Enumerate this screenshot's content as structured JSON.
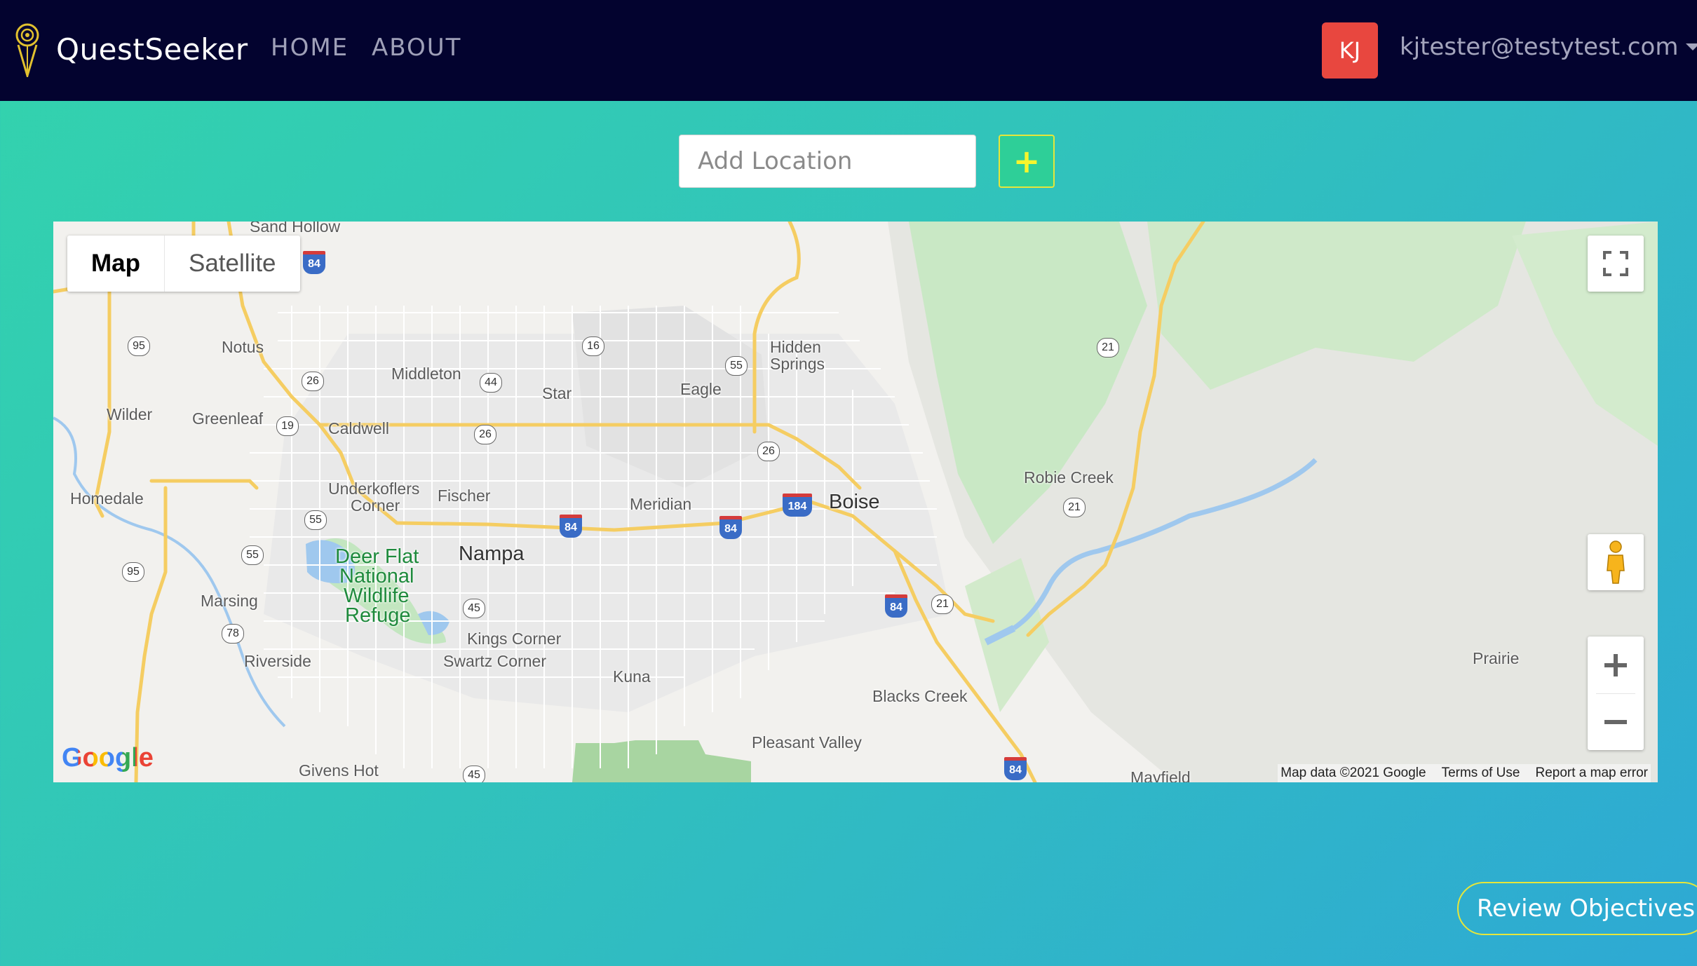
{
  "nav": {
    "brand": "QuestSeeker",
    "home": "HOME",
    "about": "ABOUT",
    "avatar_initials": "KJ",
    "user_email": "kjtester@testytest.com"
  },
  "location": {
    "placeholder": "Add Location",
    "add_label": "+"
  },
  "map": {
    "type_map": "Map",
    "type_satellite": "Satellite",
    "google": "Google",
    "attribution": [
      "Map data ©2021 Google",
      "Terms of Use",
      "Report a map error"
    ],
    "places": {
      "sand_hollow": "Sand Hollow",
      "notus": "Notus",
      "middleton": "Middleton",
      "star": "Star",
      "eagle": "Eagle",
      "hidden": "Hidden",
      "springs": "Springs",
      "wilder": "Wilder",
      "greenleaf": "Greenleaf",
      "caldwell": "Caldwell",
      "underkoflers": "Underkoflers",
      "corner": "Corner",
      "fischer": "Fischer",
      "meridian": "Meridian",
      "boise": "Boise",
      "robie_creek": "Robie Creek",
      "homedale": "Homedale",
      "nampa": "Nampa",
      "deer_flat_1": "Deer Flat",
      "deer_flat_2": "National",
      "deer_flat_3": "Wildlife",
      "deer_flat_4": "Refuge",
      "marsing": "Marsing",
      "kings_corner": "Kings Corner",
      "swartz_corner": "Swartz Corner",
      "kuna": "Kuna",
      "riverside": "Riverside",
      "blacks_creek": "Blacks Creek",
      "pleasant_valley": "Pleasant Valley",
      "prairie": "Prairie",
      "givens_hot": "Givens Hot",
      "mayfield": "Mayfield"
    },
    "shields": {
      "r95a": "95",
      "r26a": "26",
      "r44": "44",
      "r16": "16",
      "r55a": "55",
      "r21a": "21",
      "r19": "19",
      "r26b": "26",
      "r26c": "26",
      "r21b": "21",
      "r55b": "55",
      "r55c": "55",
      "r95b": "95",
      "r45a": "45",
      "r78": "78",
      "r21c": "21",
      "r45b": "45"
    },
    "interstates": {
      "i84a": "84",
      "i84b": "84",
      "i84c": "84",
      "i184": "184",
      "i84d": "84",
      "i84e": "84"
    }
  },
  "review_label": "Review Objectives"
}
